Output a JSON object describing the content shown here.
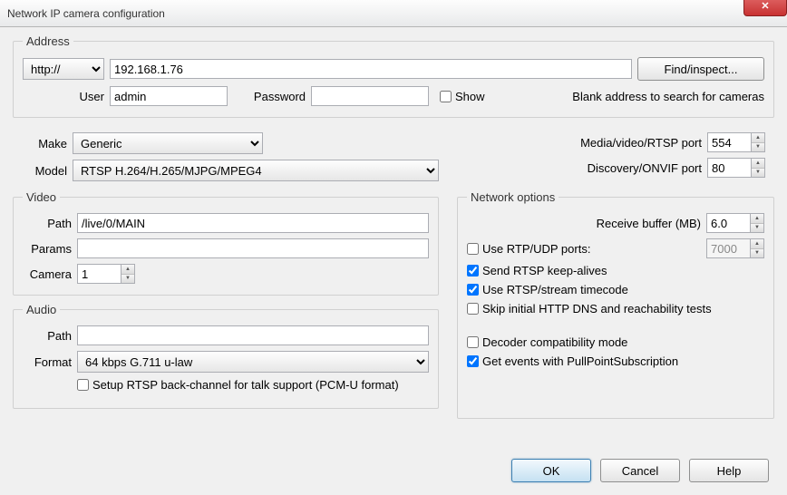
{
  "window": {
    "title": "Network IP camera configuration"
  },
  "address": {
    "legend": "Address",
    "protocol": "http://",
    "host": "192.168.1.76",
    "find_label": "Find/inspect...",
    "user_label": "User",
    "user_value": "admin",
    "password_label": "Password",
    "password_value": "",
    "show_label": "Show",
    "blank_hint": "Blank address to search for cameras"
  },
  "makemodel": {
    "make_label": "Make",
    "make_value": "Generic",
    "model_label": "Model",
    "model_value": "RTSP H.264/H.265/MJPG/MPEG4"
  },
  "ports": {
    "rtsp_label": "Media/video/RTSP port",
    "rtsp_value": "554",
    "onvif_label": "Discovery/ONVIF port",
    "onvif_value": "80"
  },
  "video": {
    "legend": "Video",
    "path_label": "Path",
    "path_value": "/live/0/MAIN",
    "params_label": "Params",
    "params_value": "",
    "camera_label": "Camera",
    "camera_value": "1"
  },
  "audio": {
    "legend": "Audio",
    "path_label": "Path",
    "path_value": "",
    "format_label": "Format",
    "format_value": "64 kbps G.711 u-law",
    "backchannel_label": "Setup RTSP back-channel for talk support (PCM-U format)"
  },
  "network": {
    "legend": "Network options",
    "recv_buf_label": "Receive buffer (MB)",
    "recv_buf_value": "6.0",
    "use_rtp_label": "Use RTP/UDP ports:",
    "rtp_port_value": "7000",
    "keepalive_label": "Send RTSP keep-alives",
    "timecode_label": "Use RTSP/stream timecode",
    "skip_dns_label": "Skip initial HTTP DNS and reachability tests",
    "decoder_compat_label": "Decoder compatibility mode",
    "pullpoint_label": "Get events with PullPointSubscription"
  },
  "buttons": {
    "ok": "OK",
    "cancel": "Cancel",
    "help": "Help"
  }
}
